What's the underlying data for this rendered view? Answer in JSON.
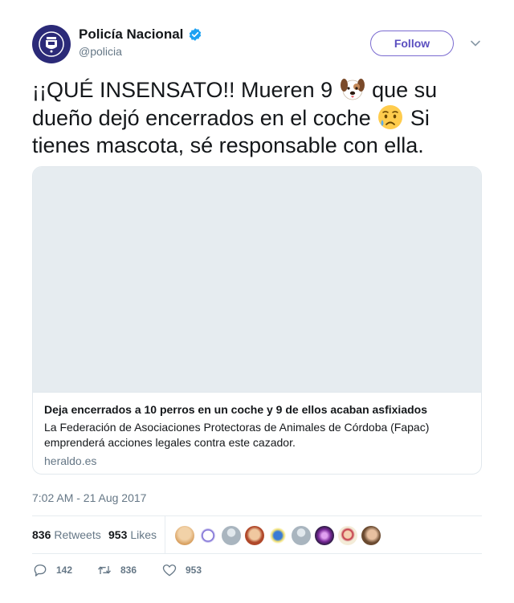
{
  "account": {
    "display_name": "Policía Nacional",
    "handle": "@policia",
    "follow_label": "Follow"
  },
  "tweet": {
    "text_part1": "¡¡QUÉ INSENSATO!! Mueren 9 ",
    "text_part2": " que su dueño dejó encerrados en el coche ",
    "text_part3": " Si tienes mascota, sé responsable con ella.",
    "emoji_1": "dog-face-icon",
    "emoji_2": "crying-face-icon"
  },
  "card": {
    "title": "Deja encerrados a 10 perros en un coche y 9 de ellos acaban asfixiados",
    "description": "La Federación de Asociaciones Protectoras de Animales de Córdoba (Fapac) emprenderá acciones legales contra este cazador.",
    "domain": "heraldo.es"
  },
  "timestamp": "7:02 AM - 21 Aug 2017",
  "stats": {
    "retweets_count": "836",
    "retweets_label": "Retweets",
    "likes_count": "953",
    "likes_label": "Likes"
  },
  "actions": {
    "replies": "142",
    "retweets": "836",
    "likes": "953"
  },
  "colors": {
    "accent": "#5b4fc0",
    "verified": "#1da1f2",
    "muted": "#657786"
  }
}
